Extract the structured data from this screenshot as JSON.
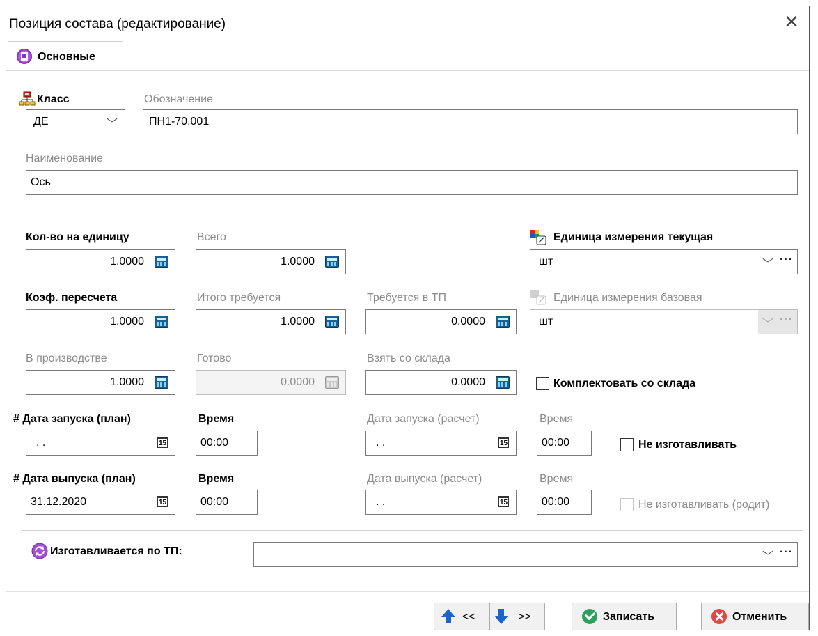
{
  "window": {
    "title": "Позиция состава (редактирование)"
  },
  "tabs": [
    {
      "label": "Основные"
    }
  ],
  "klass": {
    "label": "Класс",
    "value": "ДЕ"
  },
  "oboznachenie": {
    "label": "Обозначение",
    "value": "ПН1-70.001"
  },
  "naimenovanie": {
    "label": "Наименование",
    "value": "Ось"
  },
  "kolvo": {
    "label": "Кол-во на единицу",
    "value": "1.0000"
  },
  "vsego": {
    "label": "Всего",
    "value": "1.0000"
  },
  "unit_current": {
    "label": "Единица измерения текущая",
    "value": "шт"
  },
  "koef": {
    "label": "Коэф. пересчета",
    "value": "1.0000"
  },
  "itogo": {
    "label": "Итого требуется",
    "value": "1.0000"
  },
  "treb_tp": {
    "label": "Требуется в ТП",
    "value": "0.0000"
  },
  "unit_base": {
    "label": "Единица измерения базовая",
    "value": "шт"
  },
  "v_proizv": {
    "label": "В производстве",
    "value": "1.0000"
  },
  "gotovo": {
    "label": "Готово",
    "value": "0.0000"
  },
  "vzyat": {
    "label": "Взять со склада",
    "value": "0.0000"
  },
  "komplekt": {
    "label": "Комплектовать со склада",
    "checked": false
  },
  "start_plan": {
    "label": "# Дата запуска (план)",
    "value": ". .",
    "time_label": "Время",
    "time": "00:00"
  },
  "start_calc": {
    "label": "Дата запуска (расчет)",
    "value": ". .",
    "time_label": "Время",
    "time": "00:00"
  },
  "ne_izgot": {
    "label": "Не изготавливать",
    "checked": false
  },
  "end_plan": {
    "label": "# Дата выпуска (план)",
    "value": "31.12.2020",
    "time_label": "Время",
    "time": "00:00"
  },
  "end_calc": {
    "label": "Дата выпуска (расчет)",
    "value": ". .",
    "time_label": "Время",
    "time": "00:00"
  },
  "ne_izgot_rodit": {
    "label": "Не изготавливать (родит)",
    "checked": false
  },
  "izgot_tp": {
    "label": "Изготавливается по ТП:",
    "value": ""
  },
  "calendar_glyph": "15",
  "buttons": {
    "prev": "<<",
    "next": ">>",
    "save": "Записать",
    "cancel": "Отменить"
  },
  "icons": {
    "close": "close-icon",
    "tab": "list-icon",
    "class": "class-tree-icon",
    "unit": "unit-icon",
    "calc": "calculator-icon",
    "date": "calendar-icon",
    "tp": "process-icon",
    "up": "arrow-up-icon",
    "down": "arrow-down-icon",
    "save": "check-icon",
    "cancel": "cancel-icon"
  }
}
